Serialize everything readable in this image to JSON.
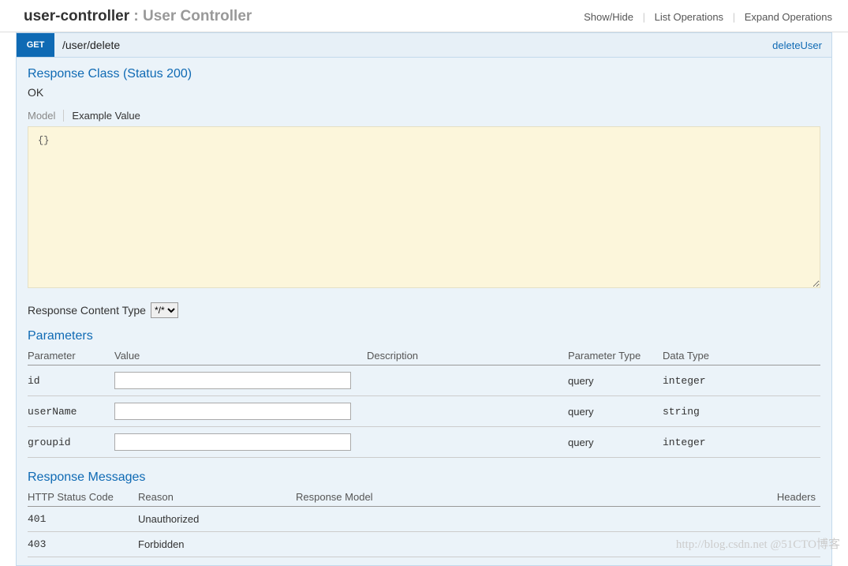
{
  "header": {
    "controller_key": "user-controller",
    "separator": " : ",
    "controller_desc": "User Controller",
    "links": {
      "show_hide": "Show/Hide",
      "list_ops": "List Operations",
      "expand_ops": "Expand Operations"
    }
  },
  "operation": {
    "method": "GET",
    "path": "/user/delete",
    "name": "deleteUser"
  },
  "response_class": {
    "heading": "Response Class (Status 200)",
    "status_text": "OK",
    "tabs": {
      "model": "Model",
      "example": "Example Value"
    },
    "example_body": "{}"
  },
  "response_content_type": {
    "label": "Response Content Type",
    "selected": "*/*"
  },
  "parameters": {
    "heading": "Parameters",
    "columns": {
      "parameter": "Parameter",
      "value": "Value",
      "description": "Description",
      "param_type": "Parameter Type",
      "data_type": "Data Type"
    },
    "rows": [
      {
        "name": "id",
        "value": "",
        "description": "",
        "param_type": "query",
        "data_type": "integer"
      },
      {
        "name": "userName",
        "value": "",
        "description": "",
        "param_type": "query",
        "data_type": "string"
      },
      {
        "name": "groupid",
        "value": "",
        "description": "",
        "param_type": "query",
        "data_type": "integer"
      }
    ]
  },
  "response_messages": {
    "heading": "Response Messages",
    "columns": {
      "code": "HTTP Status Code",
      "reason": "Reason",
      "model": "Response Model",
      "headers": "Headers"
    },
    "rows": [
      {
        "code": "401",
        "reason": "Unauthorized",
        "model": "",
        "headers": ""
      },
      {
        "code": "403",
        "reason": "Forbidden",
        "model": "",
        "headers": ""
      }
    ]
  },
  "watermark": "http://blog.csdn.net @51CTO博客"
}
